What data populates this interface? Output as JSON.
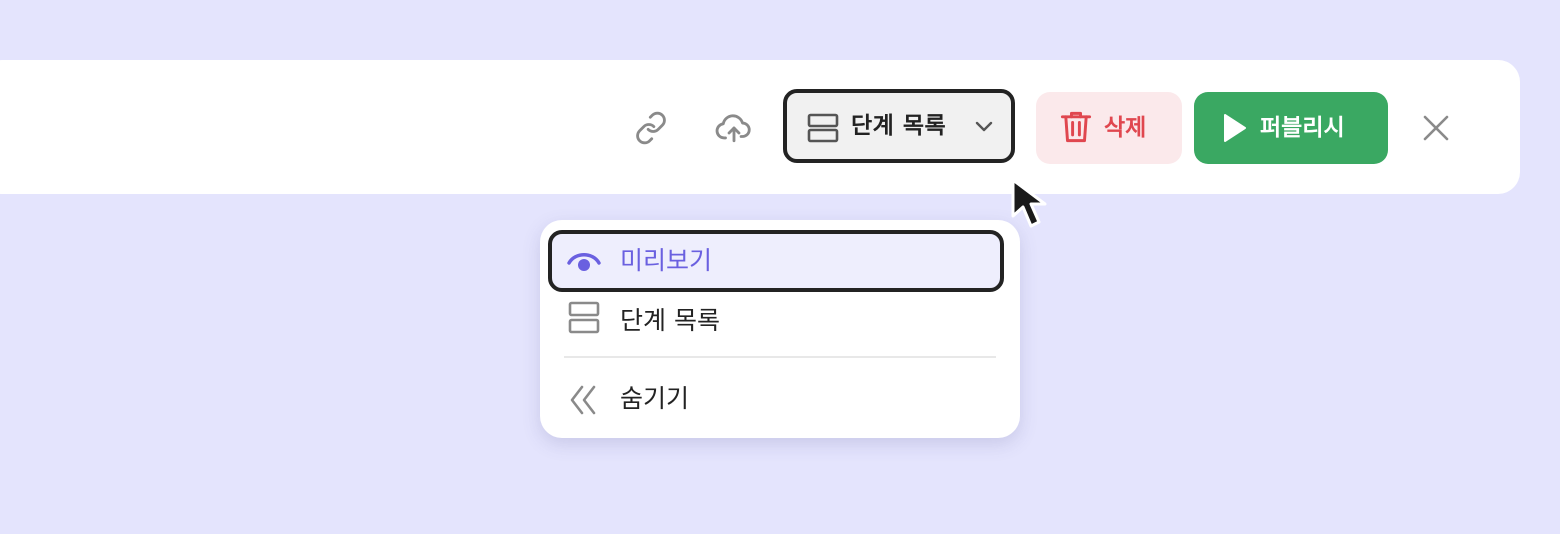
{
  "toolbar": {
    "link_icon": "link-icon",
    "upload_icon": "cloud-upload-icon",
    "view_select": {
      "icon": "steps-list-icon",
      "value": "단계 목록",
      "chevron": "chevron-down-icon"
    },
    "delete": {
      "icon": "trash-icon",
      "label": "삭제"
    },
    "publish": {
      "icon": "play-icon",
      "label": "퍼블리시"
    },
    "close_icon": "close-icon"
  },
  "dropdown": {
    "items": [
      {
        "label": "미리보기",
        "icon": "eye-icon",
        "active": true
      },
      {
        "label": "단계 목록",
        "icon": "steps-list-icon",
        "active": false
      },
      {
        "label": "숨기기",
        "icon": "double-chevron-left-icon",
        "active": false
      }
    ]
  },
  "colors": {
    "background": "#e4e4fd",
    "accent": "#6a60e0",
    "danger": "#e0474f",
    "danger_bg": "#fbe9eb",
    "success": "#3aa862"
  }
}
